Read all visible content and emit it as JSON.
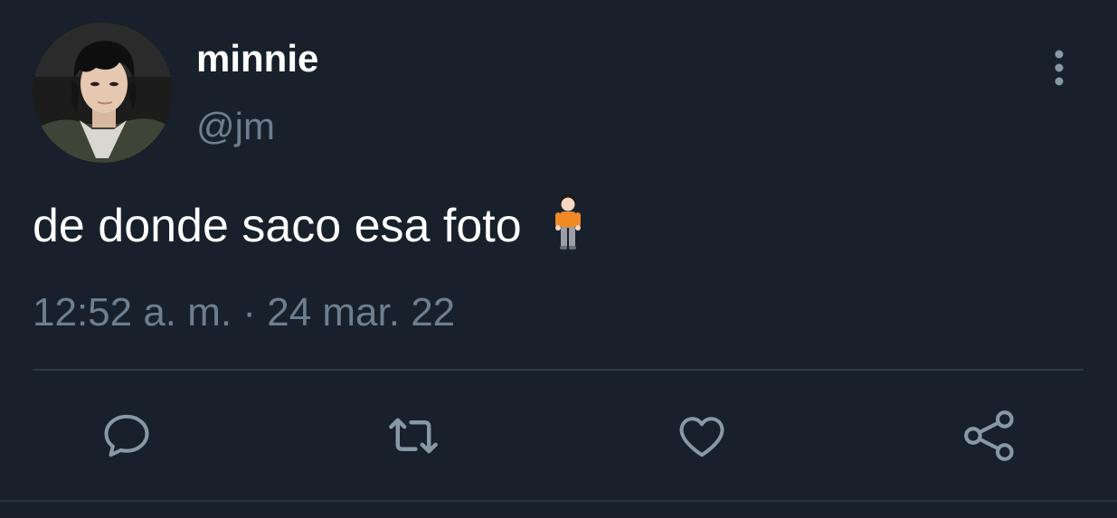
{
  "tweet": {
    "author": {
      "display_name": "minnie",
      "handle": "@jm",
      "avatar_icon": "profile-photo"
    },
    "text": "de donde saco esa foto",
    "emoji": "person-standing-emoji",
    "timestamp": "12:52 a. m. · 24 mar. 22"
  },
  "actions": {
    "reply_icon": "reply-icon",
    "retweet_icon": "retweet-icon",
    "like_icon": "heart-icon",
    "share_icon": "share-icon",
    "more_icon": "more-vertical-icon"
  },
  "colors": {
    "background": "#17202b",
    "secondary_text": "#6d7f90",
    "icon": "#8899a6",
    "divider": "#2f3a47"
  }
}
